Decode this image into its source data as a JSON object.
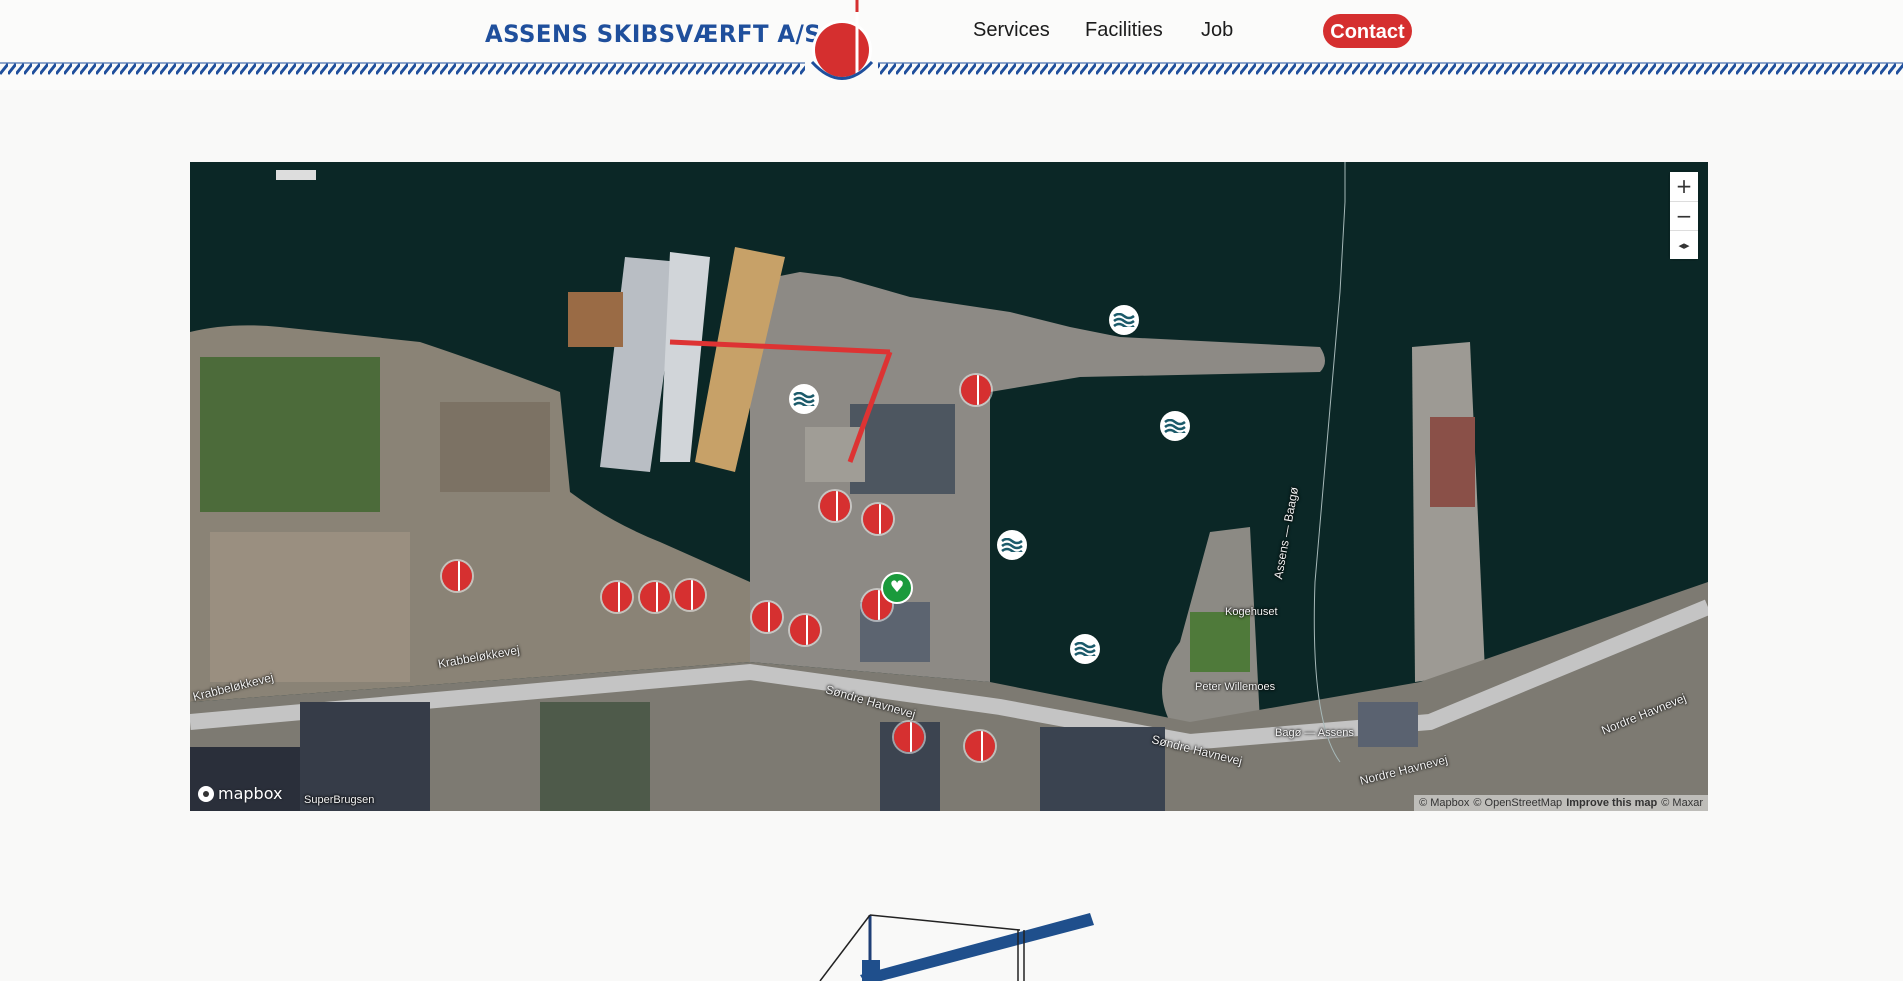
{
  "header": {
    "brand": "ASSENS SKIBSVÆRFT A/S",
    "nav": [
      "Services",
      "Facilities",
      "Job"
    ],
    "contact_label": "Contact",
    "colors": {
      "brand_blue": "#1f4f9c",
      "accent_red": "#d52f2f"
    }
  },
  "map": {
    "zoom_in": "+",
    "zoom_out": "−",
    "compass": "◂▸",
    "logo": "mapbox",
    "attribution": [
      "© Mapbox",
      "© OpenStreetMap",
      "Improve this map",
      "© Maxar"
    ],
    "streets": {
      "krabbelokkevej_1": "Krabbeløkkevej",
      "krabbelokkevej_2": "Krabbeløkkevej",
      "sondre_havnevej_1": "Søndre Havnevej",
      "sondre_havnevej_2": "Søndre Havnevej",
      "nordre_havnevej_1": "Nordre Havnevej",
      "nordre_havnevej_2": "Nordre Havnevej",
      "assens_baago": "Assens — Baagø"
    },
    "places": {
      "kogehuset": "Kogehuset",
      "peter_willemoes": "Peter Willemoes",
      "bago_assens": "Bagø — Assens",
      "superbrugsen": "SuperBrugsen"
    },
    "icons": {
      "marker": "shipyard-marker-icon",
      "water": "water-wave-icon",
      "aed": "aed-heart-icon"
    }
  }
}
